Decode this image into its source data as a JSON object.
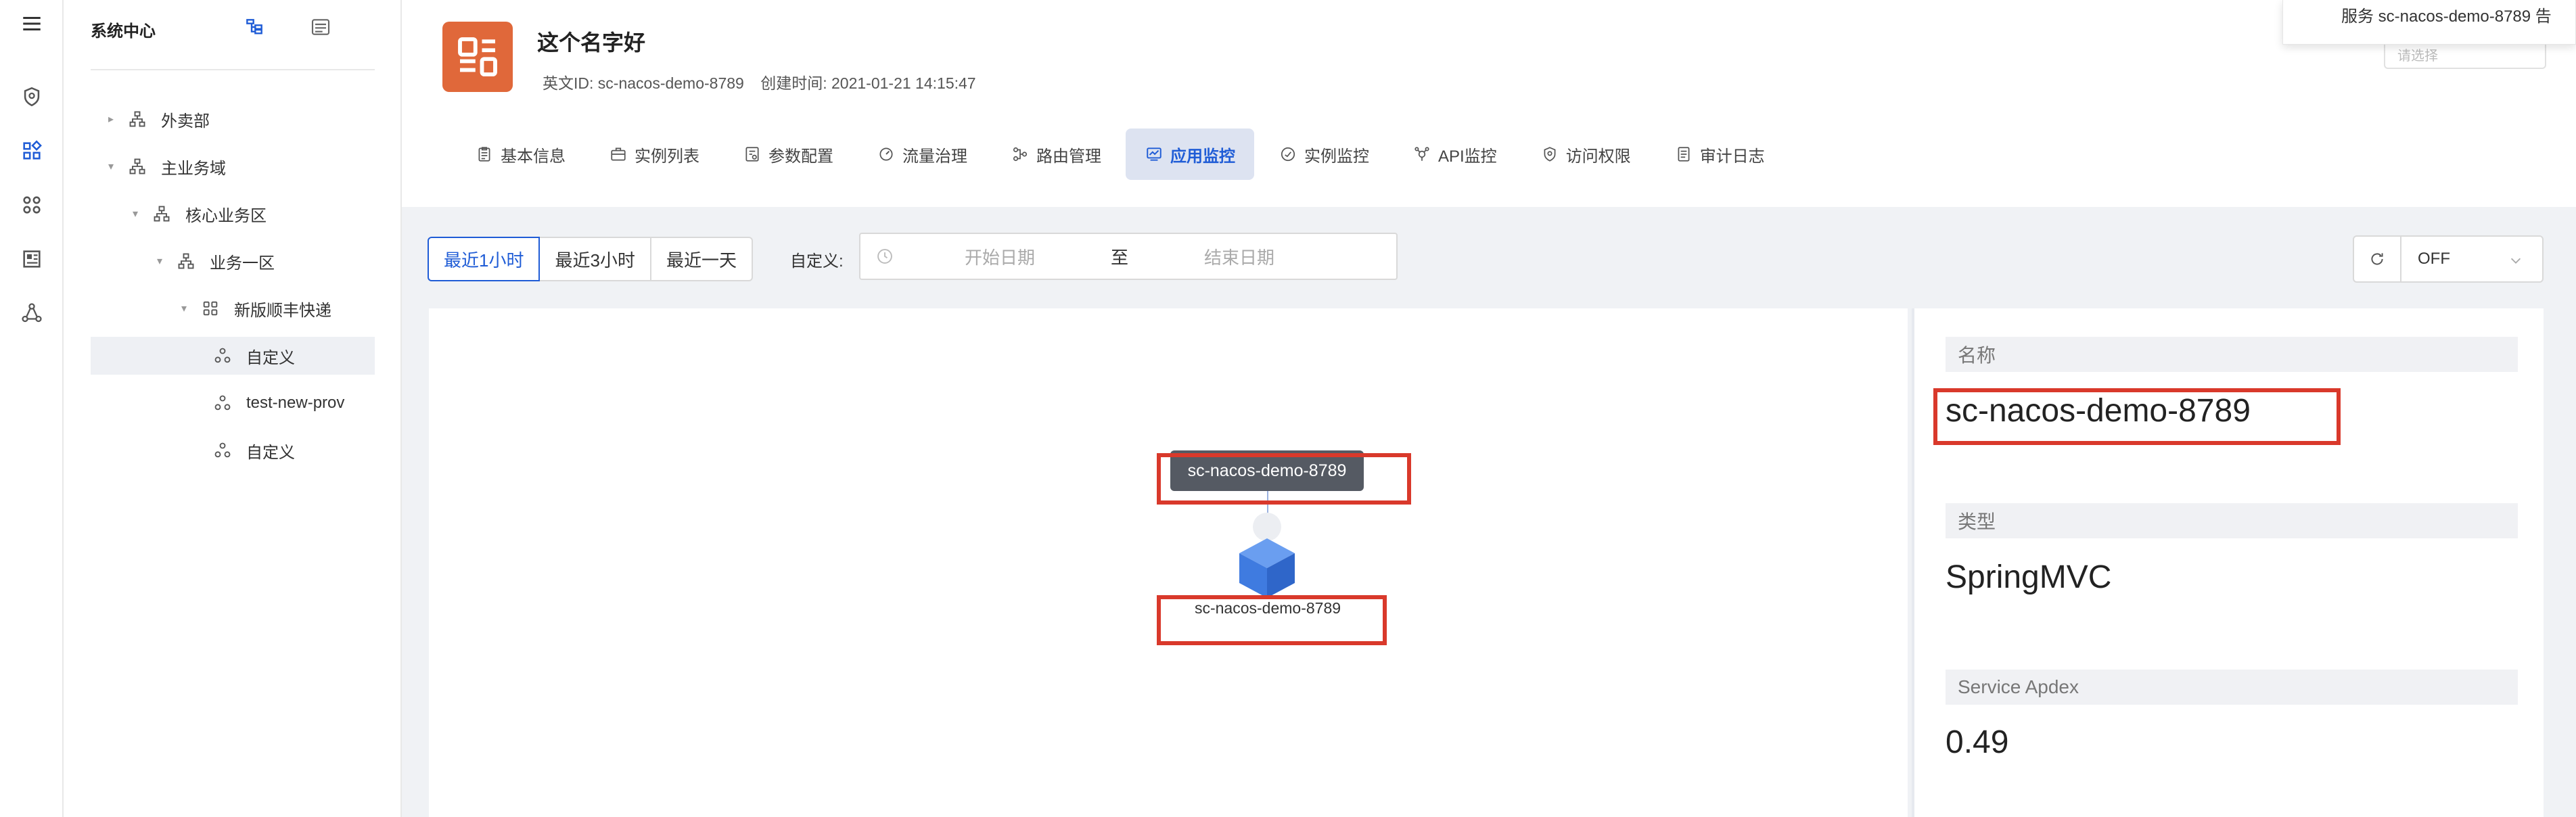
{
  "tree": {
    "title": "系统中心",
    "items": [
      {
        "label": "外卖部",
        "expanded": false
      },
      {
        "label": "主业务域",
        "expanded": true
      },
      {
        "label": "核心业务区",
        "expanded": true
      },
      {
        "label": "业务一区",
        "expanded": true
      },
      {
        "label": "新版顺丰快递",
        "expanded": true
      },
      {
        "label": "自定义",
        "selected": true
      },
      {
        "label": "test-new-prov"
      },
      {
        "label": "自定义"
      }
    ]
  },
  "app": {
    "name": "这个名字好",
    "english_id": "英文ID: sc-nacos-demo-8789",
    "created": "创建时间: 2021-01-21 14:15:47"
  },
  "tabs": [
    {
      "label": "基本信息",
      "icon": "clipboard-icon"
    },
    {
      "label": "实例列表",
      "icon": "briefcase-icon"
    },
    {
      "label": "参数配置",
      "icon": "settings-doc-icon"
    },
    {
      "label": "流量治理",
      "icon": "gauge-icon"
    },
    {
      "label": "路由管理",
      "icon": "route-icon"
    },
    {
      "label": "应用监控",
      "icon": "monitor-icon",
      "active": true
    },
    {
      "label": "实例监控",
      "icon": "dashboard-icon"
    },
    {
      "label": "API监控",
      "icon": "api-icon"
    },
    {
      "label": "访问权限",
      "icon": "shield-icon"
    },
    {
      "label": "审计日志",
      "icon": "log-icon"
    }
  ],
  "toolbar": {
    "ranges": [
      "最近1小时",
      "最近3小时",
      "最近一天"
    ],
    "active_range": "最近1小时",
    "custom_label": "自定义:",
    "start_placeholder": "开始日期",
    "separator": "至",
    "end_placeholder": "结束日期",
    "refresh_value": "OFF"
  },
  "graph": {
    "tooltip": "sc-nacos-demo-8789",
    "node_label": "sc-nacos-demo-8789"
  },
  "detail": {
    "name_label": "名称",
    "name_value": "sc-nacos-demo-8789",
    "type_label": "类型",
    "type_value": "SpringMVC",
    "apdex_label": "Service Apdex",
    "apdex_value": "0.49"
  },
  "notification": {
    "text": "服务 sc-nacos-demo-8789 告"
  },
  "peek_select": {
    "placeholder": "请选择"
  },
  "colors": {
    "accent": "#1f5cd6",
    "logo": "#e0683a",
    "highlight": "#d9392b"
  }
}
